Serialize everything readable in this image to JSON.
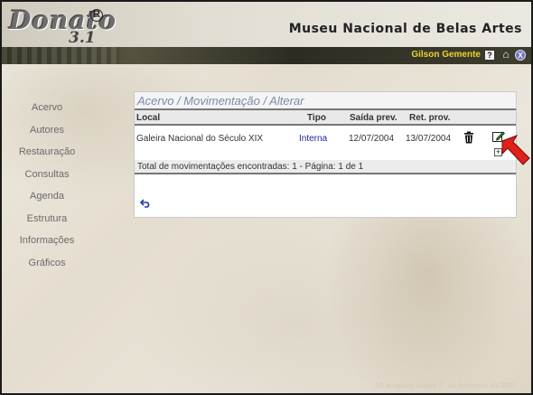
{
  "app": {
    "logo_name": "Donato",
    "logo_version": "3.1",
    "logo_reg": "R",
    "museum_title": "Museu Nacional de Belas Artes"
  },
  "userbar": {
    "user_name": "Gilson Gemente",
    "help_glyph": "?",
    "logout_glyph": "X"
  },
  "nav": {
    "items": [
      "Acervo",
      "Autores",
      "Restauração",
      "Consultas",
      "Agenda",
      "Estrutura",
      "Informações",
      "Gráficos"
    ]
  },
  "panel": {
    "breadcrumb": "Acervo / Movimentação / Alterar",
    "columns": {
      "local": "Local",
      "tipo": "Tipo",
      "saida": "Saída prev.",
      "retorno": "Ret. prov."
    },
    "rows": [
      {
        "local": "Galeira Nacional do Século XIX",
        "tipo": "Interna",
        "saida": "12/07/2004",
        "retorno": "13/07/2004"
      }
    ],
    "expand_glyph": "+",
    "summary": "Total de movimentações encontradas: 1 - Página: 1 de 1"
  },
  "footer": {
    "note": "10 acessos desde 1º de fevereiro de 2002"
  },
  "colors": {
    "accent_user": "#e8d531",
    "link": "#1a28a0",
    "breadcrumb": "#7b8aa8",
    "pointer": "#e0201a"
  },
  "icons": {
    "help": "help-icon",
    "home": "home-icon",
    "logout": "logout-icon",
    "trash": "trash-icon",
    "edit": "edit-icon",
    "expand": "expand-icon",
    "back": "back-icon",
    "pointer": "red-arrow-pointer-icon"
  }
}
